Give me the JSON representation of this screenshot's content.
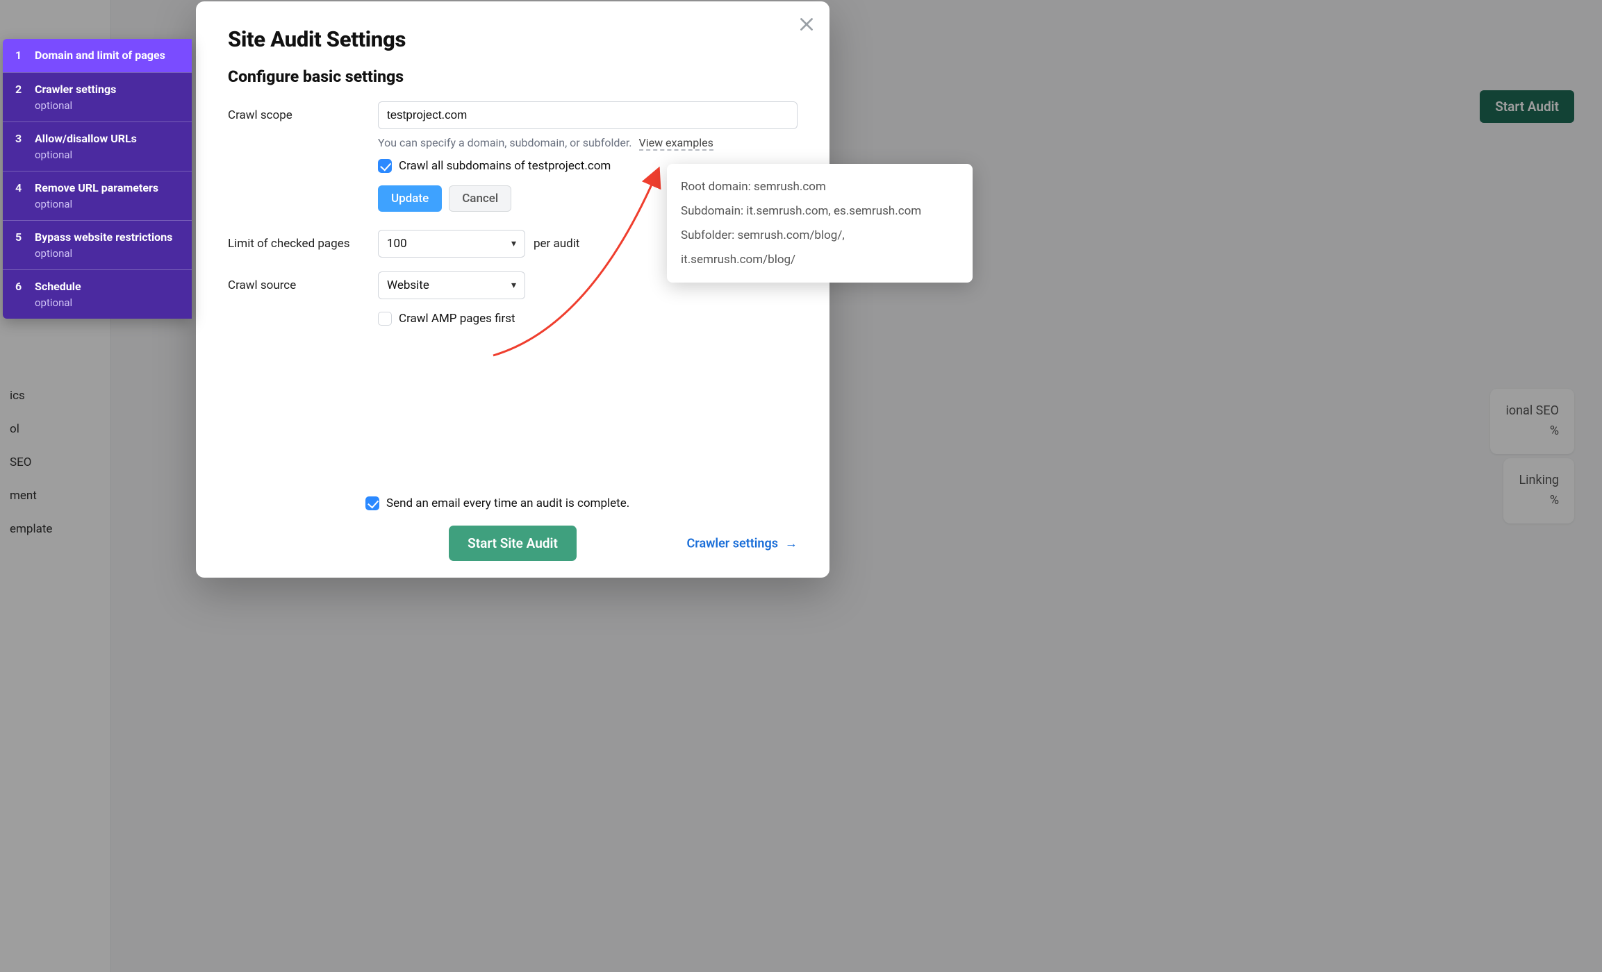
{
  "bg": {
    "start_audit": "Start Audit",
    "sidebar_items": [
      "ics",
      "ol",
      "SEO",
      "ment",
      "emplate"
    ],
    "chip1_top": "ional SEO",
    "chip1_bottom": "%",
    "chip2_top": "Linking",
    "chip2_bottom": "%"
  },
  "wizard": {
    "steps": [
      {
        "num": "1",
        "title": "Domain and limit of pages",
        "optional": "",
        "active": true
      },
      {
        "num": "2",
        "title": "Crawler settings",
        "optional": "optional",
        "active": false
      },
      {
        "num": "3",
        "title": "Allow/disallow URLs",
        "optional": "optional",
        "active": false
      },
      {
        "num": "4",
        "title": "Remove URL parameters",
        "optional": "optional",
        "active": false
      },
      {
        "num": "5",
        "title": "Bypass website restrictions",
        "optional": "optional",
        "active": false
      },
      {
        "num": "6",
        "title": "Schedule",
        "optional": "optional",
        "active": false
      }
    ]
  },
  "modal": {
    "title": "Site Audit Settings",
    "subtitle": "Configure basic settings",
    "crawl_scope_label": "Crawl scope",
    "crawl_scope_value": "testproject.com",
    "crawl_scope_hint": "You can specify a domain, subdomain, or subfolder.",
    "view_examples": "View examples",
    "crawl_subdomains": "Crawl all subdomains of testproject.com",
    "update_btn": "Update",
    "cancel_btn": "Cancel",
    "limit_label": "Limit of checked pages",
    "limit_value": "100",
    "limit_suffix": "per audit",
    "source_label": "Crawl source",
    "source_value": "Website",
    "crawl_amp": "Crawl AMP pages first",
    "email_label": "Send an email every time an audit is complete.",
    "start_btn": "Start Site Audit",
    "next_link": "Crawler settings"
  },
  "popover": {
    "line1": "Root domain: semrush.com",
    "line2": "Subdomain: it.semrush.com, es.semrush.com",
    "line3": "Subfolder: semrush.com/blog/, it.semrush.com/blog/"
  }
}
